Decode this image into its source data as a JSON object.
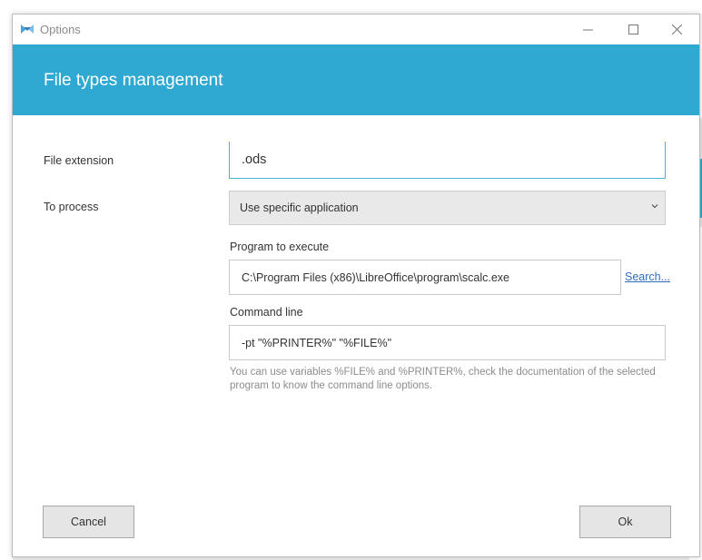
{
  "window": {
    "title": "Options",
    "controls": {
      "minimize": "—",
      "maximize": "☐",
      "close": "✕"
    }
  },
  "header": {
    "title": "File types management"
  },
  "form": {
    "file_extension": {
      "label": "File extension",
      "value": ".ods"
    },
    "to_process": {
      "label": "To process",
      "selected": "Use specific application"
    },
    "program": {
      "label": "Program to execute",
      "value": "C:\\Program Files (x86)\\LibreOffice\\program\\scalc.exe",
      "search_link": "Search..."
    },
    "command_line": {
      "label": "Command line",
      "value": "-pt \"%PRINTER%\" \"%FILE%\"",
      "help": "You can use variables %FILE% and %PRINTER%, check the documentation of the selected program to know the command line options."
    }
  },
  "buttons": {
    "cancel": "Cancel",
    "ok": "Ok"
  },
  "colors": {
    "accent": "#2fa8d2",
    "link": "#2f6fc0"
  }
}
